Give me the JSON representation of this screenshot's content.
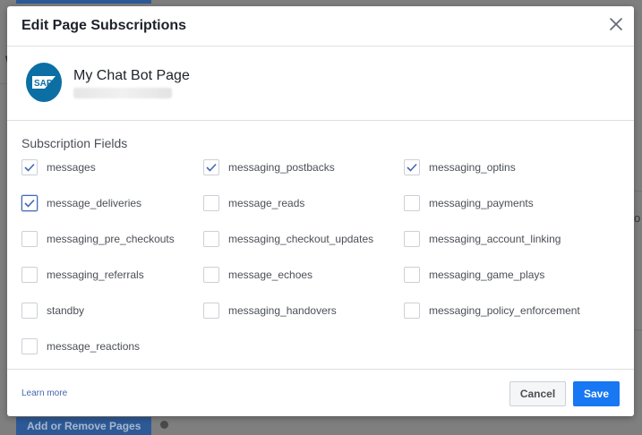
{
  "background": {
    "bottom_button_label": "Add or Remove Pages"
  },
  "modal": {
    "title": "Edit Page Subscriptions",
    "page": {
      "name": "My Chat Bot Page",
      "logo_text": "SAP"
    },
    "fields_title": "Subscription Fields",
    "fields": [
      {
        "label": "messages",
        "checked": true
      },
      {
        "label": "messaging_postbacks",
        "checked": true
      },
      {
        "label": "messaging_optins",
        "checked": true
      },
      {
        "label": "message_deliveries",
        "checked": true
      },
      {
        "label": "message_reads",
        "checked": false
      },
      {
        "label": "messaging_payments",
        "checked": false
      },
      {
        "label": "messaging_pre_checkouts",
        "checked": false
      },
      {
        "label": "messaging_checkout_updates",
        "checked": false
      },
      {
        "label": "messaging_account_linking",
        "checked": false
      },
      {
        "label": "messaging_referrals",
        "checked": false
      },
      {
        "label": "message_echoes",
        "checked": false
      },
      {
        "label": "messaging_game_plays",
        "checked": false
      },
      {
        "label": "standby",
        "checked": false
      },
      {
        "label": "messaging_handovers",
        "checked": false
      },
      {
        "label": "messaging_policy_enforcement",
        "checked": false
      },
      {
        "label": "message_reactions",
        "checked": false
      }
    ],
    "footer": {
      "learn_more": "Learn more",
      "cancel_label": "Cancel",
      "save_label": "Save"
    }
  },
  "colors": {
    "primary": "#1877f2",
    "link": "#4267b2",
    "overlay": "#7f7f7f",
    "sap_blue": "#0b6fa4"
  }
}
